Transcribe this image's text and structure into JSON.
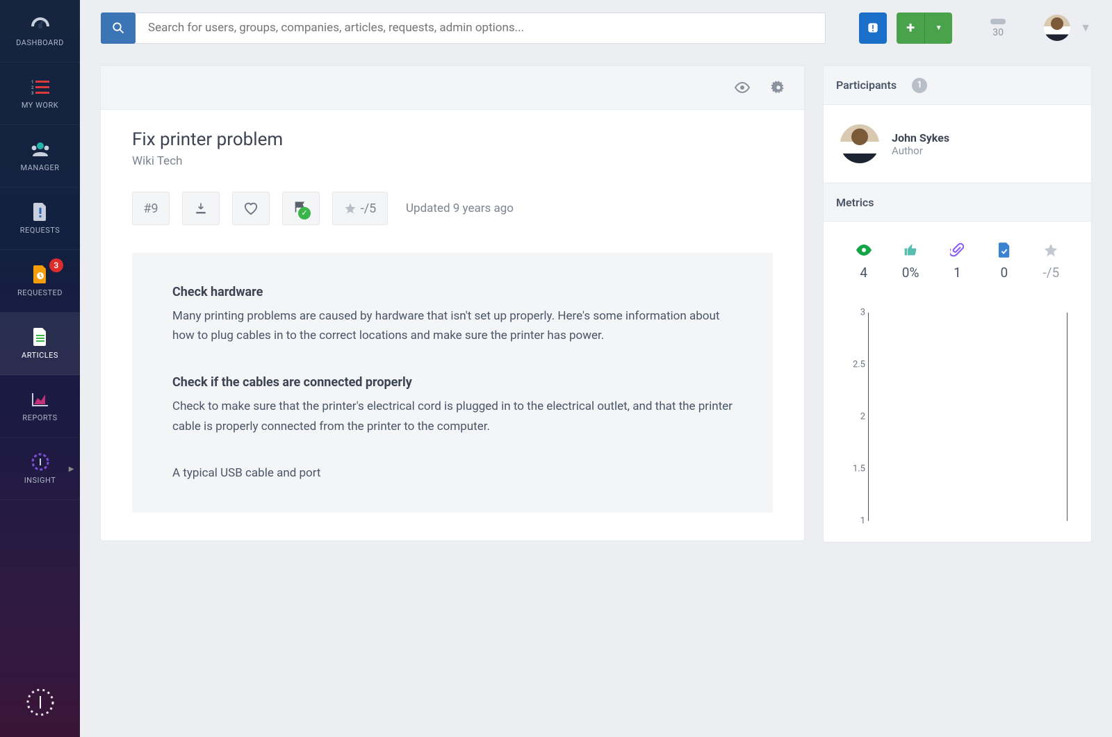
{
  "header": {
    "search_placeholder": "Search for users, groups, companies, articles, requests, admin options...",
    "points": "30"
  },
  "sidebar": {
    "items": [
      {
        "label": "DASHBOARD"
      },
      {
        "label": "MY WORK"
      },
      {
        "label": "MANAGER"
      },
      {
        "label": "REQUESTS"
      },
      {
        "label": "REQUESTED",
        "badge": "3"
      },
      {
        "label": "ARTICLES"
      },
      {
        "label": "REPORTS"
      },
      {
        "label": "INSIGHT"
      }
    ]
  },
  "article": {
    "title": "Fix printer problem",
    "subtitle": "Wiki Tech",
    "number": "#9",
    "rating_label": "-/5",
    "updated": "Updated 9 years ago",
    "content": {
      "h1": "Check hardware",
      "p1": "Many printing problems are caused by hardware that isn't set up properly. Here's some information about how to plug cables in to the correct locations and make sure the printer has power.",
      "h2": "Check if the cables are connected properly",
      "p2": "Check to make sure that the printer's electrical cord is plugged in to the electrical outlet, and that the printer cable is properly connected from the printer to the computer.",
      "p3": "A typical USB cable and port"
    }
  },
  "participants": {
    "title": "Participants",
    "count": "1",
    "person": {
      "name": "John Sykes",
      "role": "Author"
    }
  },
  "metrics": {
    "title": "Metrics",
    "views": "4",
    "likes": "0%",
    "attachments": "1",
    "tasks": "0",
    "rating": "-/5"
  },
  "chart_data": {
    "type": "line",
    "ylim": [
      0.5,
      3
    ],
    "yticks": [
      "3",
      "2.5",
      "2",
      "1.5",
      "1"
    ],
    "series": [
      {
        "name": "views",
        "values": []
      }
    ]
  }
}
